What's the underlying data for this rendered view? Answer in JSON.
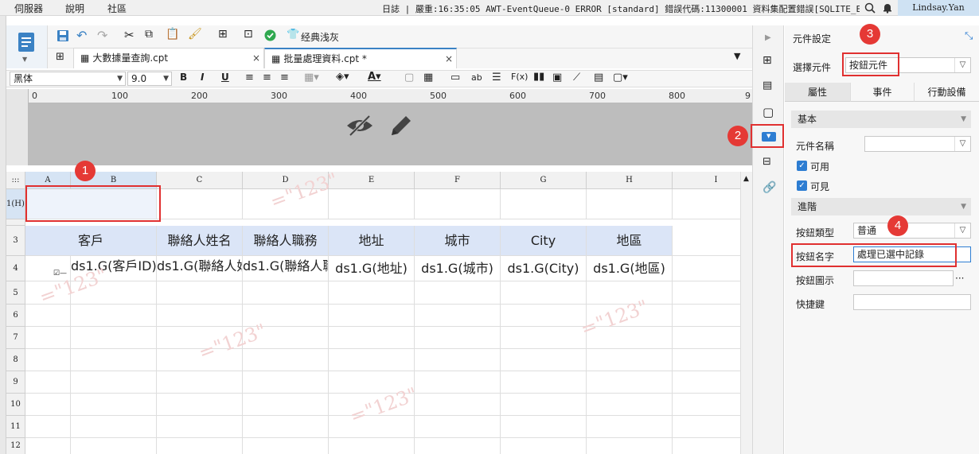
{
  "menubar": {
    "items": [
      "伺服器",
      "說明",
      "社區"
    ],
    "log_text": "日誌 | 嚴重:16:35:05 AWT-EventQueue-0 ERROR [standard] 錯誤代碼:11300001 資料集配置錯誤[SQLITE_ER...",
    "user": "Lindsay.Yan"
  },
  "toolbar": {
    "theme_label": "经典浅灰"
  },
  "tabs": [
    {
      "label": "大數據量查詢.cpt",
      "close": "×"
    },
    {
      "label": "批量處理資料.cpt *",
      "close": "×"
    }
  ],
  "format": {
    "font_name": "黑体",
    "font_size": "9.0",
    "bold": "B",
    "italic": "I",
    "underline": "U"
  },
  "ruler": {
    "ticks": [
      "0",
      "100",
      "200",
      "300",
      "400",
      "500",
      "600",
      "700",
      "800",
      "9"
    ]
  },
  "grid": {
    "corner": ":::",
    "columns": [
      "A",
      "B",
      "C",
      "D",
      "E",
      "F",
      "G",
      "H",
      "I"
    ],
    "rows": [
      "1(H)",
      "",
      "3",
      "4",
      "5",
      "6",
      "7",
      "8",
      "9",
      "10",
      "11",
      "12"
    ],
    "header_cells": [
      "客戶",
      "聯絡人姓名",
      "聯絡人職務",
      "地址",
      "城市",
      "City",
      "地區"
    ],
    "data_cells": [
      "ds1.G(客戶ID)",
      "ds1.G(聯絡人姓名)",
      "ds1.G(聯絡人職務)",
      "ds1.G(地址)",
      "ds1.G(城市)",
      "ds1.G(City)",
      "ds1.G(地區)"
    ],
    "watermark": "=\"123\""
  },
  "panel": {
    "title": "元件設定",
    "select_label": "選擇元件",
    "select_value": "按鈕元件",
    "tabs": [
      "屬性",
      "事件",
      "行動設備"
    ],
    "section_basic": "基本",
    "name_label": "元件名稱",
    "name_value": "",
    "available": "可用",
    "visible": "可見",
    "section_advanced": "進階",
    "btn_type_label": "按鈕類型",
    "btn_type_value": "普通",
    "btn_name_label": "按鈕名字",
    "btn_name_value": "處理已選中記錄",
    "btn_icon_label": "按鈕圖示",
    "btn_icon_more": "···",
    "shortcut_label": "快捷鍵"
  },
  "badges": [
    "1",
    "2",
    "3",
    "4"
  ],
  "colors": {
    "accent": "#2d7dd2",
    "annotation_red": "#e03030",
    "header_cell": "#dbe5f7"
  }
}
